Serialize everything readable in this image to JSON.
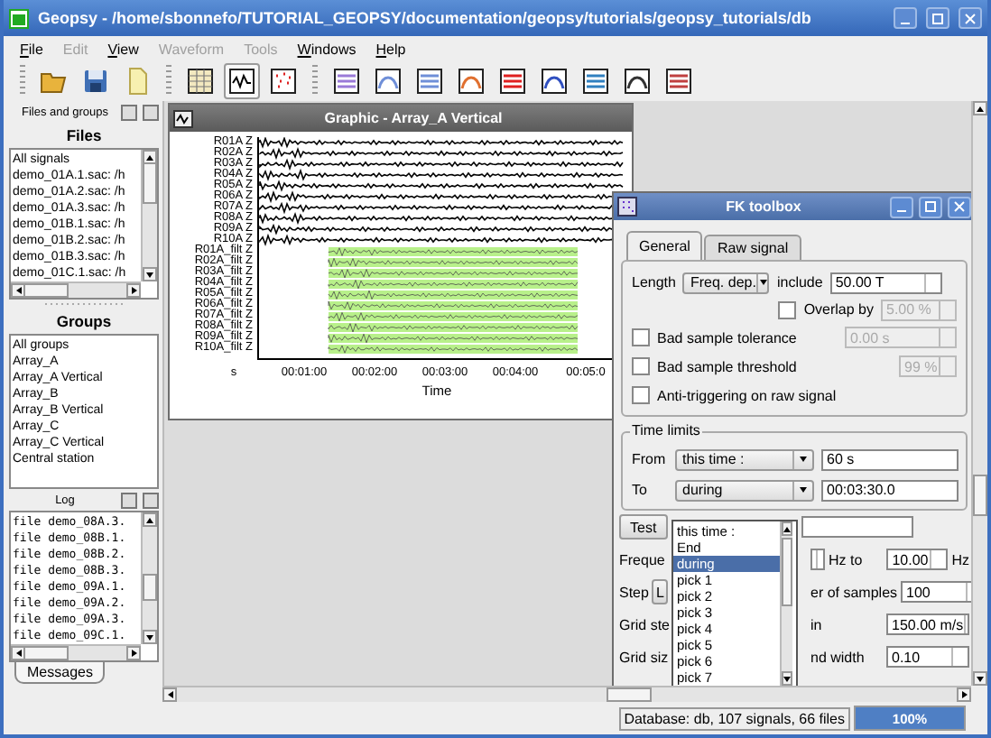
{
  "window": {
    "title": "Geopsy - /home/sbonnefo/TUTORIAL_GEOPSY/documentation/geopsy/tutorials/geopsy_tutorials/db"
  },
  "menu": [
    {
      "label": "File",
      "disabled": false
    },
    {
      "label": "Edit",
      "disabled": true
    },
    {
      "label": "View",
      "disabled": false
    },
    {
      "label": "Waveform",
      "disabled": true
    },
    {
      "label": "Tools",
      "disabled": true
    },
    {
      "label": "Windows",
      "disabled": false
    },
    {
      "label": "Help",
      "disabled": false
    }
  ],
  "toolbar": [
    {
      "selected": false
    },
    {
      "selected": false
    },
    {
      "selected": false
    },
    {
      "selected": false
    },
    {
      "selected": true
    },
    {
      "selected": false
    },
    {
      "selected": false
    },
    {
      "selected": false
    },
    {
      "selected": false
    },
    {
      "selected": false
    },
    {
      "selected": false
    },
    {
      "selected": false
    },
    {
      "selected": false
    },
    {
      "selected": false
    },
    {
      "selected": false
    }
  ],
  "dock": {
    "title": "Files and groups",
    "files": {
      "title": "Files",
      "items": [
        "All signals",
        "demo_01A.1.sac: /h",
        "demo_01A.2.sac: /h",
        "demo_01A.3.sac: /h",
        "demo_01B.1.sac: /h",
        "demo_01B.2.sac: /h",
        "demo_01B.3.sac: /h",
        "demo_01C.1.sac: /h"
      ]
    },
    "groups": {
      "title": "Groups",
      "items": [
        "All groups",
        "Array_A",
        "Array_A Vertical",
        "Array_B",
        "Array_B Vertical",
        "Array_C",
        "Array_C Vertical",
        "Central station"
      ]
    }
  },
  "log": {
    "title": "Log",
    "lines": [
      "file demo_08A.3.",
      "file demo_08B.1.",
      "file demo_08B.2.",
      "file demo_08B.3.",
      "file demo_09A.1.",
      "file demo_09A.2.",
      "file demo_09A.3.",
      "file demo_09C.1."
    ],
    "tab": "Messages"
  },
  "graphic": {
    "title": "Graphic - Array_A Vertical",
    "signals": [
      "R01A Z",
      "R02A Z",
      "R03A Z",
      "R04A Z",
      "R05A Z",
      "R06A Z",
      "R07A Z",
      "R08A Z",
      "R09A Z",
      "R10A Z"
    ],
    "filtered": [
      "R01A_filt Z",
      "R02A_filt Z",
      "R03A_filt Z",
      "R04A_filt Z",
      "R05A_filt Z",
      "R06A_filt Z",
      "R07A_filt Z",
      "R08A_filt Z",
      "R09A_filt Z",
      "R10A_filt Z"
    ],
    "ticks": [
      "s",
      "00:01:00",
      "00:02:00",
      "00:03:00",
      "00:04:00",
      "00:05:0"
    ],
    "axis_title": "Time"
  },
  "fk": {
    "title": "FK toolbox",
    "tabs": [
      {
        "label": "General",
        "selected": true
      },
      {
        "label": "Raw signal",
        "selected": false
      }
    ],
    "length": {
      "label": "Length",
      "combo": "Freq. dep.",
      "include_label": "include",
      "value": "50.00 T"
    },
    "overlap": {
      "label": "Overlap by",
      "checked": false,
      "value": "5.00 %",
      "disabled": true
    },
    "checks": [
      {
        "label": "Bad sample tolerance",
        "checked": false,
        "value": "0.00 s",
        "disabled": true
      },
      {
        "label": "Bad sample threshold",
        "checked": false,
        "value": "99 %",
        "disabled": true
      },
      {
        "label": "Anti-triggering on raw signal",
        "checked": false
      }
    ],
    "time_limits": {
      "title": "Time limits",
      "rows": [
        {
          "label": "From",
          "combo": "this time :",
          "value": "60 s"
        },
        {
          "label": "To",
          "combo": "during",
          "value": "00:03:30.0"
        }
      ]
    },
    "dropdown": [
      {
        "label": "this time :",
        "selected": false
      },
      {
        "label": "End",
        "selected": false
      },
      {
        "label": "during",
        "selected": true
      },
      {
        "label": "pick 1",
        "selected": false
      },
      {
        "label": "pick 2",
        "selected": false
      },
      {
        "label": "pick 3",
        "selected": false
      },
      {
        "label": "pick 4",
        "selected": false
      },
      {
        "label": "pick 5",
        "selected": false
      },
      {
        "label": "pick 6",
        "selected": false
      },
      {
        "label": "pick 7",
        "selected": false
      }
    ],
    "test_button": "Test",
    "rows": [
      {
        "label": "Freque",
        "leading_spin": true,
        "mid": "Hz to",
        "value": "10.00",
        "unit": "Hz"
      },
      {
        "label": "Step",
        "button": "L",
        "mid": "er of samples",
        "value": "100"
      },
      {
        "label": "Grid ste",
        "mid": "in",
        "value": "150.00 m/s"
      },
      {
        "label": "Grid siz",
        "mid": "nd width",
        "value": "0.10"
      }
    ]
  },
  "status": {
    "text": "Database: db, 107 signals, 66 files",
    "progress": {
      "level": 1,
      "label": "100%"
    }
  }
}
